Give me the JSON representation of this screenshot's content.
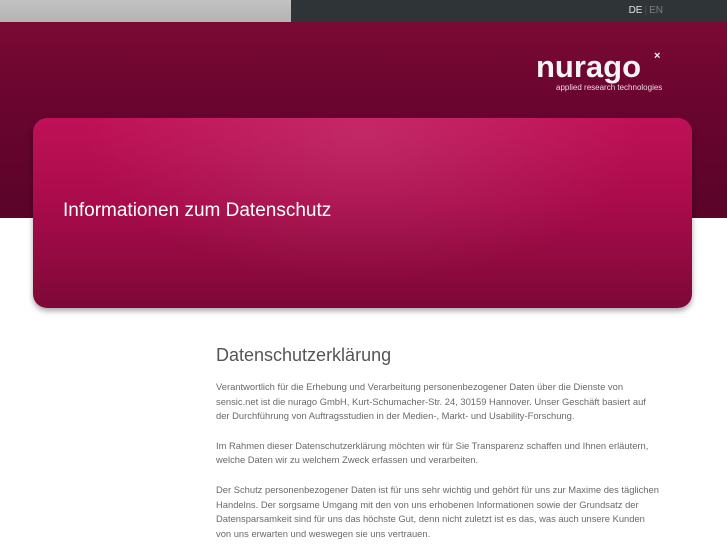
{
  "topbar": {
    "lang_de": "DE",
    "lang_sep": "|",
    "lang_en": "EN"
  },
  "logo": {
    "word": "nurago",
    "mark": "×",
    "tagline": "applied research technologies"
  },
  "hero": {
    "title": "Informationen zum Datenschutz"
  },
  "main": {
    "heading": "Datenschutzerklärung",
    "paragraphs": [
      "Verantwortlich für die Erhebung und Verarbeitung personenbezogener Daten über die Dienste von sensic.net ist die nurago GmbH, Kurt-Schumacher-Str. 24, 30159 Hannover. Unser Geschäft basiert auf der Durchführung von Auftragsstudien in der Medien-, Markt- und Usability-Forschung.",
      "Im Rahmen dieser Datenschutzerklärung möchten wir für Sie Transparenz schaffen und Ihnen erläutern, welche Daten wir zu welchem Zweck erfassen und verarbeiten.",
      "Der Schutz personenbezogener Daten ist für uns sehr wichtig und gehört für uns zur Maxime des täglichen Handelns. Der sorgsame Umgang mit den von uns erhobenen Informationen sowie der Grundsatz der Datensparsamkeit sind für uns das höchste Gut, denn nicht zuletzt ist es das, was auch unsere Kunden von uns erwarten und weswegen sie uns vertrauen."
    ]
  },
  "colors": {
    "brand_dark": "#6a0530",
    "brand_hero": "#a90b4b",
    "topbar": "#2f3437"
  }
}
